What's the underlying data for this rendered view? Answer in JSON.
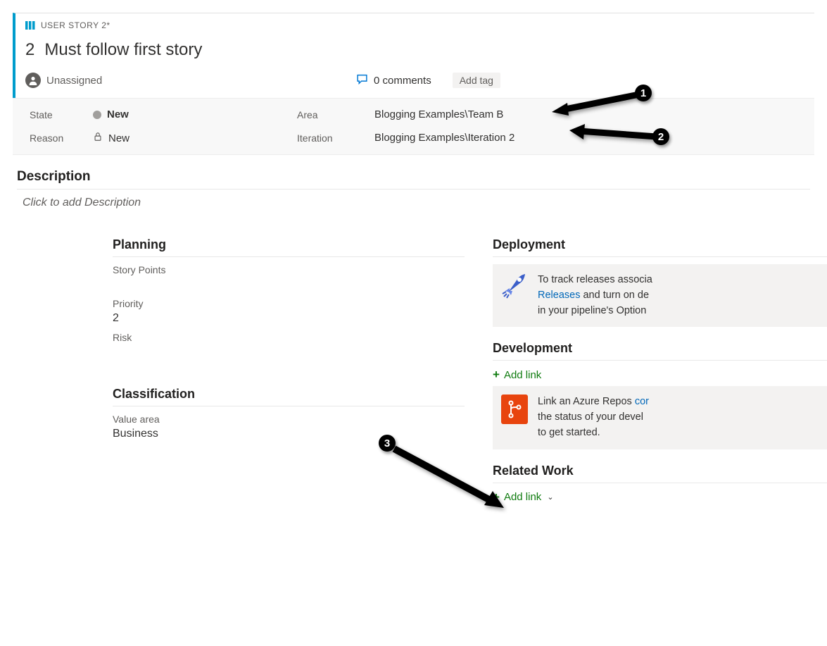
{
  "header": {
    "type_label": "USER STORY 2*",
    "id": "2",
    "title": "Must follow first story",
    "assignee": "Unassigned",
    "comments_count": "0 comments",
    "add_tag": "Add tag"
  },
  "fields": {
    "state_label": "State",
    "state_value": "New",
    "reason_label": "Reason",
    "reason_value": "New",
    "area_label": "Area",
    "area_value": "Blogging Examples\\Team B",
    "iteration_label": "Iteration",
    "iteration_value": "Blogging Examples\\Iteration 2"
  },
  "description": {
    "heading": "Description",
    "placeholder": "Click to add Description"
  },
  "planning": {
    "heading": "Planning",
    "story_points_label": "Story Points",
    "priority_label": "Priority",
    "priority_value": "2",
    "risk_label": "Risk"
  },
  "classification": {
    "heading": "Classification",
    "value_area_label": "Value area",
    "value_area_value": "Business"
  },
  "deployment": {
    "heading": "Deployment",
    "info_pre": "To track releases associa",
    "info_link": "Releases",
    "info_mid": " and turn on de",
    "info_post": "in your pipeline's Option"
  },
  "development": {
    "heading": "Development",
    "add_link": "Add link",
    "info_pre": "Link an Azure Repos ",
    "info_link": "cor",
    "info_mid": "the status of your devel",
    "info_post": "to get started."
  },
  "related": {
    "heading": "Related Work",
    "add_link": "Add link"
  },
  "callouts": {
    "c1": "1",
    "c2": "2",
    "c3": "3"
  }
}
